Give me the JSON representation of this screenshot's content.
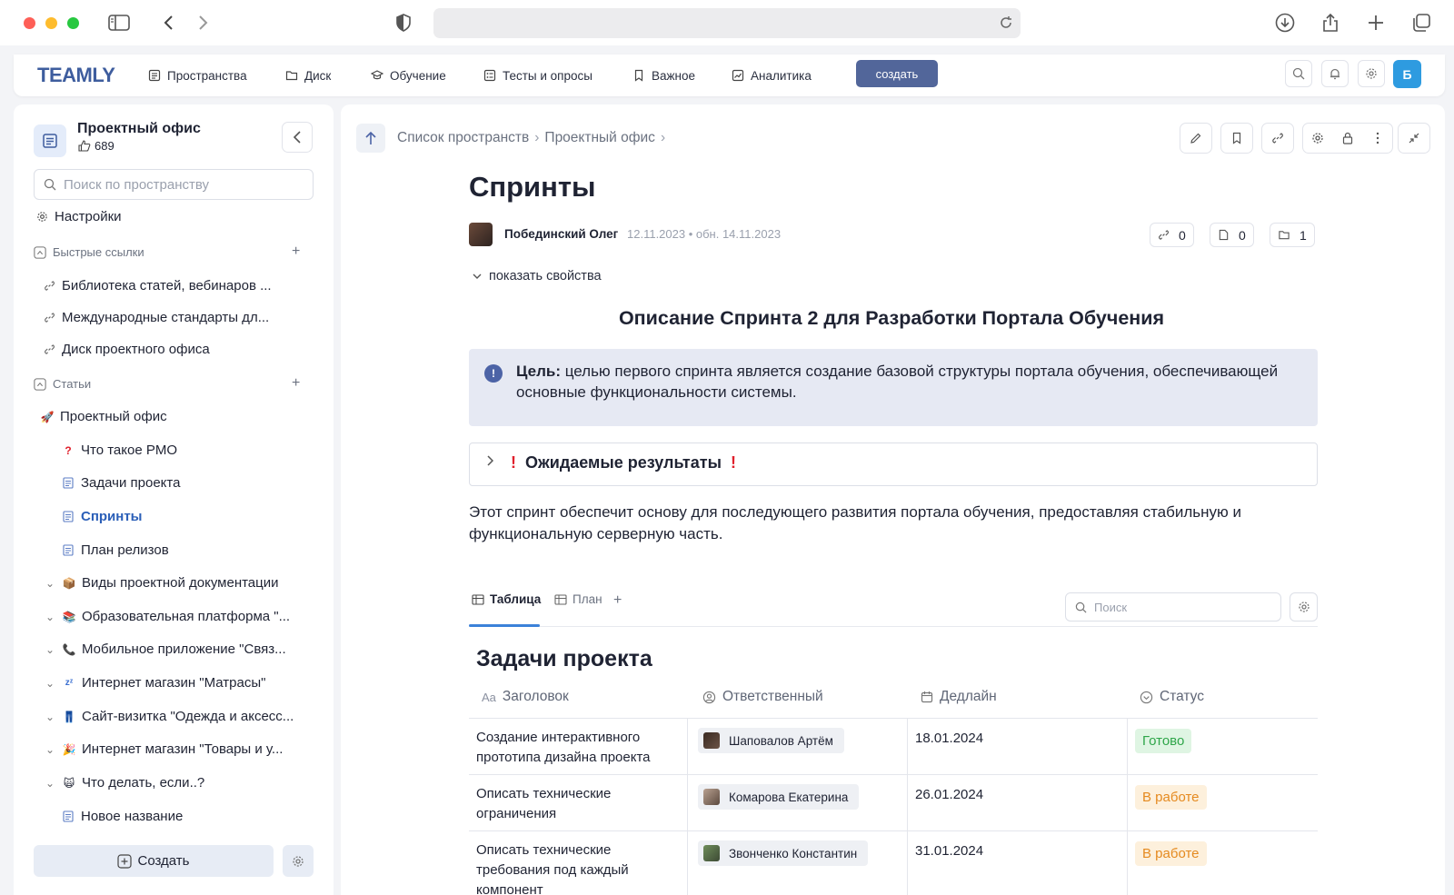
{
  "browser": {
    "icons": [
      "sidebar-toggle-icon",
      "back-icon",
      "forward-icon",
      "shield-icon",
      "reload-icon",
      "download-icon",
      "share-icon",
      "new-tab-icon",
      "tabs-overview-icon"
    ]
  },
  "topnav": {
    "logo": "TEAMLY",
    "items": [
      {
        "label": "Пространства",
        "icon": "spaces-icon"
      },
      {
        "label": "Диск",
        "icon": "folder-icon"
      },
      {
        "label": "Обучение",
        "icon": "graduation-icon"
      },
      {
        "label": "Тесты и опросы",
        "icon": "tests-icon"
      },
      {
        "label": "Важное",
        "icon": "bookmark-icon"
      },
      {
        "label": "Аналитика",
        "icon": "analytics-icon"
      }
    ],
    "create_label": "создать",
    "avatar_letter": "Б",
    "accent_color": "#52669a"
  },
  "sidebar": {
    "space_title": "Проектный офис",
    "likes": "689",
    "search_placeholder": "Поиск по пространству",
    "settings_label": "Настройки",
    "quick_links_label": "Быстрые ссылки",
    "quick_links": [
      "Библиотека статей, вебинаров ...",
      "Международные стандарты дл...",
      "Диск проектного офиса"
    ],
    "articles_label": "Статьи",
    "articles": [
      {
        "emoji": "🚀",
        "label": "Проектный офис",
        "level": 0
      },
      {
        "emoji": "❓",
        "label": "Что такое PMO",
        "level": 1
      },
      {
        "emoji": "doc",
        "label": "Задачи проекта",
        "level": 1
      },
      {
        "emoji": "doc",
        "label": "Спринты",
        "level": 1,
        "active": true
      },
      {
        "emoji": "doc",
        "label": "План релизов",
        "level": 1
      },
      {
        "emoji": "📦",
        "label": "Виды проектной документации",
        "level": 1,
        "expandable": true
      },
      {
        "emoji": "📚",
        "label": "Образовательная платформа \"...",
        "level": 1,
        "expandable": true
      },
      {
        "emoji": "📞",
        "label": "Мобильное приложение \"Связ...",
        "level": 1,
        "expandable": true
      },
      {
        "emoji": "💤",
        "label": "Интернет магазин \"Матрасы\"",
        "level": 1,
        "expandable": true
      },
      {
        "emoji": "👖",
        "label": "Сайт-визитка \"Одежда и аксесс...",
        "level": 1,
        "expandable": true
      },
      {
        "emoji": "🎉",
        "label": "Интернет магазин \"Товары и у...",
        "level": 1,
        "expandable": true
      },
      {
        "emoji": "🙀",
        "label": "Что делать, если..?",
        "level": 1,
        "expandable": true
      },
      {
        "emoji": "doc",
        "label": "Новое название",
        "level": 1
      }
    ],
    "create_label": "Создать"
  },
  "breadcrumb": [
    "Список пространств",
    "Проектный офис"
  ],
  "page": {
    "title": "Спринты",
    "author": "Побединский Олег",
    "date": "12.11.2023 • обн. 14.11.2023",
    "stats": {
      "links": "0",
      "pages": "0",
      "folders": "1"
    },
    "show_props": "показать свойства",
    "heading": "Описание Спринта 2 для Разработки Портала Обучения",
    "callout_bold": "Цель:",
    "callout_text": " целью первого спринта является создание базовой структуры портала обучения, обеспечивающей основные функциональности системы.",
    "toggle_title": "Ожидаемые результаты",
    "paragraph": "Этот спринт обеспечит основу для последующего развития портала обучения, предоставляя стабильную и функциональную серверную часть."
  },
  "table_view": {
    "tabs": [
      "Таблица",
      "План"
    ],
    "search_placeholder": "Поиск",
    "title": "Задачи проекта",
    "columns": [
      "Заголовок",
      "Ответственный",
      "Дедлайн",
      "Статус"
    ],
    "rows": [
      {
        "title": "Создание интерактивного прототипа дизайна проекта",
        "person": "Шаповалов Артём",
        "deadline": "18.01.2024",
        "status": "Готово",
        "status_bg": "#dff5e3",
        "status_fg": "#2fa64a"
      },
      {
        "title": "Описать технические ограничения",
        "person": "Комарова Екатерина",
        "deadline": "26.01.2024",
        "status": "В работе",
        "status_bg": "#fdf0dc",
        "status_fg": "#e58a1f"
      },
      {
        "title": "Описать технические требования под каждый компонент",
        "person": "Звонченко Константин",
        "deadline": "31.01.2024",
        "status": "В работе",
        "status_bg": "#fdf0dc",
        "status_fg": "#e58a1f"
      }
    ]
  }
}
